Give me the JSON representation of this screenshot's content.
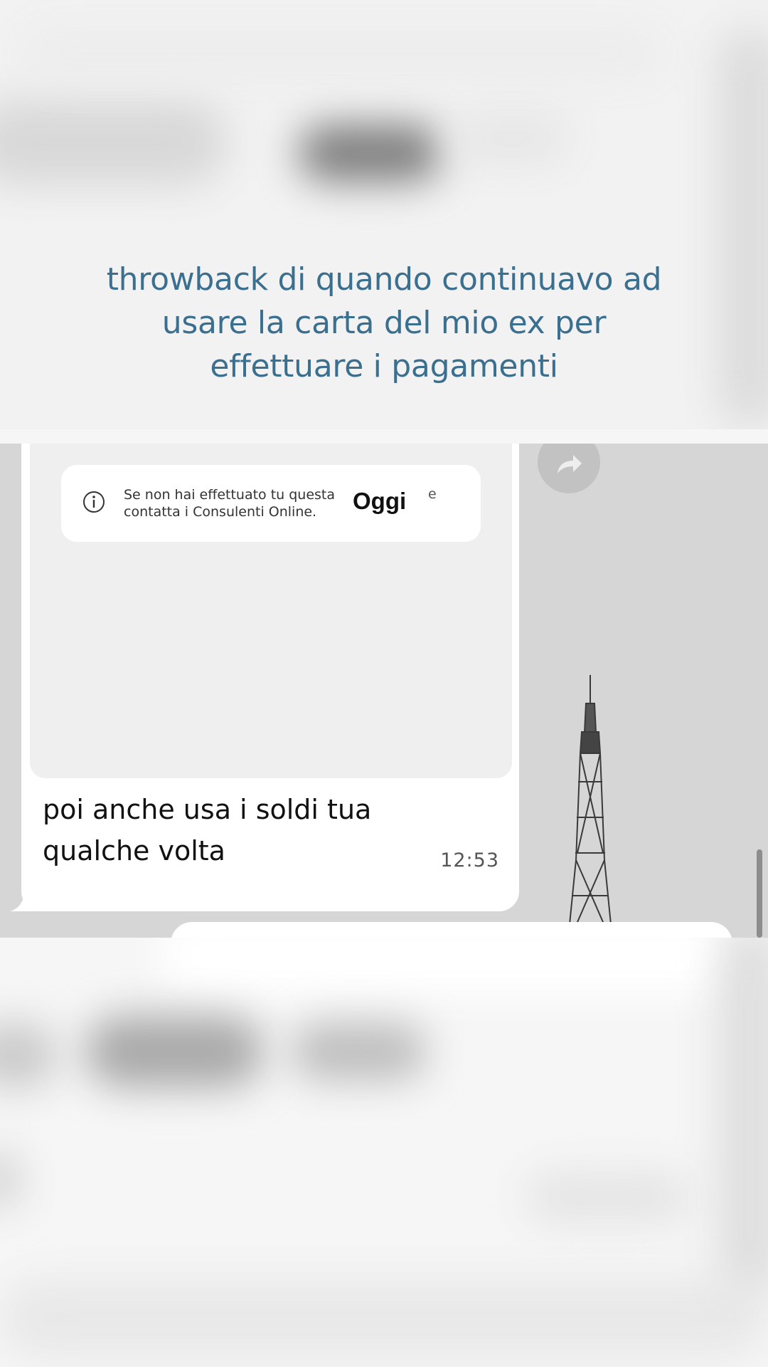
{
  "caption": {
    "lines": [
      "throwback di quando continuavo ad",
      "usare la carta del mio ex per",
      "effettuare i pagamenti"
    ]
  },
  "chat": {
    "notice": {
      "line1": "Se non hai effettuato tu questa",
      "line1_end": "e",
      "line2": "contatta i Consulenti Online."
    },
    "date_chip": "Oggi",
    "message": {
      "line1": "poi anche usa i soldi tua",
      "line2": "qualche volta",
      "time": "12:53"
    }
  },
  "colors": {
    "caption": "#3b6f90",
    "chat_background": "#d6d6d6",
    "bubble": "#ffffff"
  },
  "icons": [
    "info-icon",
    "forward-icon",
    "eiffel-tower-image"
  ]
}
